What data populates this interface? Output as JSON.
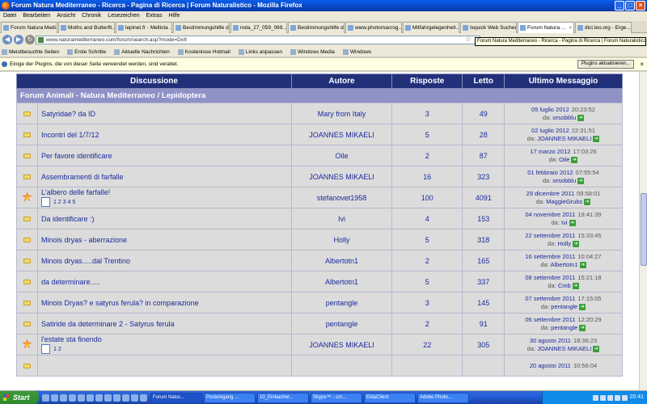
{
  "window": {
    "title": "Forum Natura Mediterraneo - Ricerca - Pagina di Ricerca | Forum Naturalistico - Mozilla Firefox"
  },
  "menu": [
    "Datei",
    "Bearbeiten",
    "Ansicht",
    "Chronik",
    "Lesezeichen",
    "Extras",
    "Hilfe"
  ],
  "tabs": [
    {
      "label": "Forum Natura Medi..."
    },
    {
      "label": "Moths and Butterfli..."
    },
    {
      "label": "lepinet.fr - Mellicta ..."
    },
    {
      "label": "Bestimmungshilfe d..."
    },
    {
      "label": "nota_27_059_069...."
    },
    {
      "label": "Bestimmungshilfe d..."
    },
    {
      "label": "www.photomacrog..."
    },
    {
      "label": "Mitfahrgelegenheit..."
    },
    {
      "label": "Ixquick Web Suchen"
    },
    {
      "label": "Forum Natura ..."
    },
    {
      "label": "dict.leo.org - Erge..."
    }
  ],
  "nav": {
    "url": "www.naturamediterraneo.com/forum/search.asp?mode=DoIt",
    "tooltip": "Forum Natura Mediterraneo - Ricerca - Pagina di Ricerca | Forum Naturalistico"
  },
  "bookmarks": [
    "Meistbesuchte Seiten",
    "Erste Schritte",
    "Aktuelle Nachrichten",
    "Kostenlose Hotmail",
    "Links anpassen",
    "Windows Media",
    "Windows"
  ],
  "notification": {
    "text": "Einige der Plugins, die von dieser Seite verwendet werden, sind veraltet.",
    "button": "Plugins aktualisieren..."
  },
  "table": {
    "headers": [
      "Discussione",
      "Autore",
      "Risposte",
      "Letto",
      "Ultimo Messaggio"
    ],
    "category": "Forum Animali - Natura Mediterraneo / Lepidoptera",
    "last_prefix": "da:",
    "rows": [
      {
        "icon": "folder",
        "title": "Satyridae? da ID",
        "author": "Mary from Italy",
        "replies": "3",
        "read": "49",
        "date": "05 luglio 2012",
        "time": "20:23:52",
        "by": "orsobblu",
        "pages": ""
      },
      {
        "icon": "folder",
        "title": "Incontri del 1/7/12",
        "author": "JOANNES MIKAELI",
        "replies": "5",
        "read": "28",
        "date": "02 luglio 2012",
        "time": "22:31:51",
        "by": "JOANNES MIKAELI",
        "pages": ""
      },
      {
        "icon": "folder",
        "title": "Per favore identificare",
        "author": "Oile",
        "replies": "2",
        "read": "87",
        "date": "17 marzo 2012",
        "time": "17:03:26",
        "by": "Oile",
        "pages": ""
      },
      {
        "icon": "folder",
        "title": "Assembramenti di farfalle",
        "author": "JOANNES MIKAELI",
        "replies": "16",
        "read": "323",
        "date": "01 febbraio 2012",
        "time": "07:55:54",
        "by": "orsobblu",
        "pages": ""
      },
      {
        "icon": "hot",
        "title": "L'albero delle farfalle!",
        "author": "stefanovet1958",
        "replies": "100",
        "read": "4091",
        "date": "29 dicembre 2011",
        "time": "09:58:01",
        "by": "MaggieGrubs",
        "pages": "1 2 3 4 5"
      },
      {
        "icon": "folder",
        "title": "Da identificare :)",
        "author": "Ivi",
        "replies": "4",
        "read": "153",
        "date": "04 novembre 2011",
        "time": "19:41:39",
        "by": "Ivi",
        "pages": ""
      },
      {
        "icon": "folder",
        "title": "Minois dryas - aberrazione",
        "author": "Holly",
        "replies": "5",
        "read": "318",
        "date": "22 settembre 2011",
        "time": "15:33:45",
        "by": "Holly",
        "pages": ""
      },
      {
        "icon": "folder",
        "title": "Minois dryas.....dal Trentino",
        "author": "Albertotn1",
        "replies": "2",
        "read": "165",
        "date": "16 settembre 2011",
        "time": "10:04:27",
        "by": "Albertotn1",
        "pages": ""
      },
      {
        "icon": "folder",
        "title": "da determinare.....",
        "author": "Albertotn1",
        "replies": "5",
        "read": "337",
        "date": "08 settembre 2011",
        "time": "15:21:18",
        "by": "Cmb",
        "pages": ""
      },
      {
        "icon": "folder",
        "title": "Minois Dryas? e satyrus ferula? in comparazione",
        "author": "pentangle",
        "replies": "3",
        "read": "145",
        "date": "07 settembre 2011",
        "time": "17:15:05",
        "by": "pentangle",
        "pages": ""
      },
      {
        "icon": "folder",
        "title": "Satiride da determinare 2 - Satyrus ferula",
        "author": "pentangle",
        "replies": "2",
        "read": "91",
        "date": "06 settembre 2011",
        "time": "12:20:29",
        "by": "pentangle",
        "pages": ""
      },
      {
        "icon": "hot",
        "title": "l'estate sta finendo",
        "author": "JOANNES MIKAELI",
        "replies": "22",
        "read": "305",
        "date": "30 agosto 2011",
        "time": "18:36:23",
        "by": "JOANNES MIKAELI",
        "pages": "1 2"
      },
      {
        "icon": "folder",
        "title": "",
        "author": "",
        "replies": "",
        "read": "",
        "date": "20 agosto 2011",
        "time": "10:56:04",
        "by": "",
        "pages": ""
      }
    ]
  },
  "taskbar": {
    "start": "Start",
    "buttons": [
      "Forum Natur...",
      "Posteingang ...",
      "10_Einbacher...",
      "Skype™ - cm...",
      "EldaClient",
      "Adobe Photo..."
    ],
    "clock": "20:41"
  }
}
